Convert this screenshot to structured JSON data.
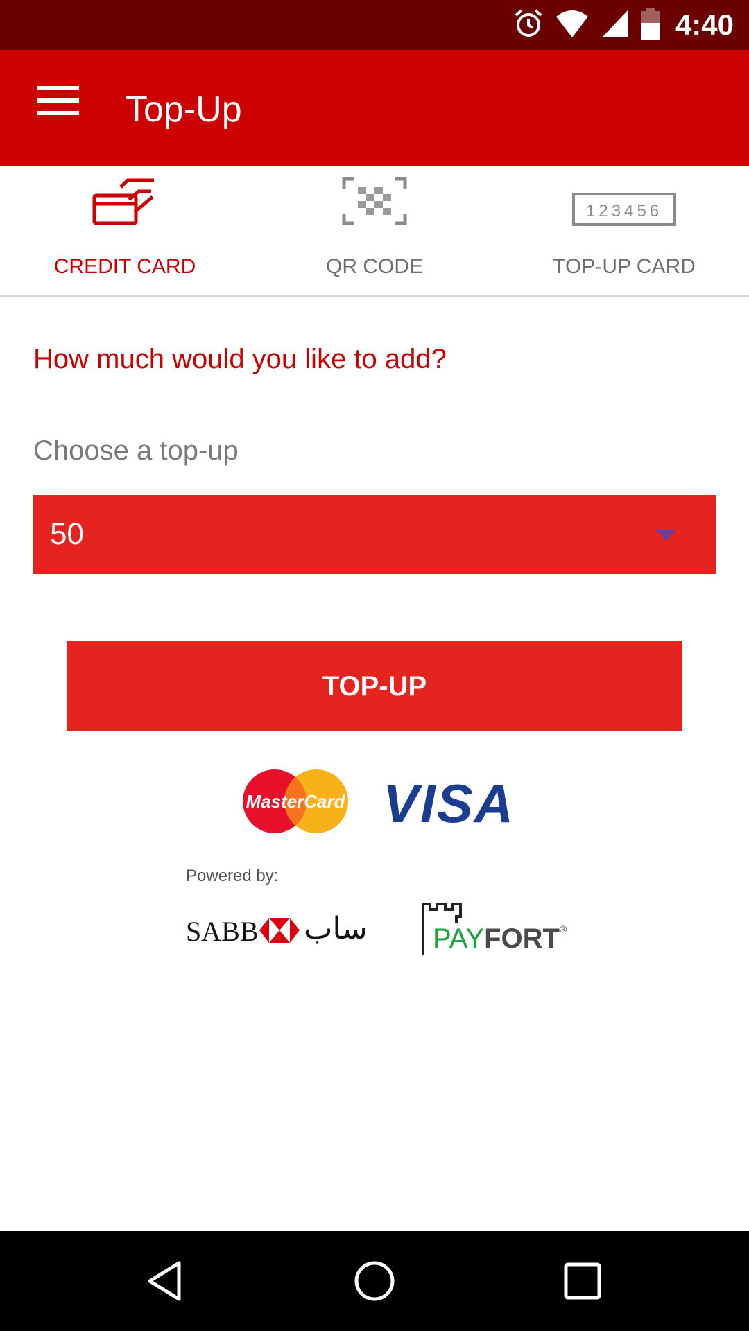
{
  "status_bar": {
    "time": "4:40",
    "icons": [
      "alarm-icon",
      "wifi-icon",
      "cell-signal-icon",
      "battery-icon"
    ]
  },
  "app_bar": {
    "title": "Top-Up",
    "menu_icon": "menu-icon"
  },
  "tabs": [
    {
      "label": "CREDIT CARD",
      "icon": "credit-card-icon",
      "active": true
    },
    {
      "label": "QR CODE",
      "icon": "qr-code-icon",
      "active": false
    },
    {
      "label": "TOP-UP CARD",
      "icon": "topup-card-icon",
      "icon_text": "123456",
      "active": false
    }
  ],
  "form": {
    "question": "How much would you like to add?",
    "choose_label": "Choose a top-up",
    "selected_amount": "50",
    "submit_label": "TOP-UP"
  },
  "payment": {
    "mastercard_text": "MasterCard",
    "visa_text": "VISA",
    "powered_by": "Powered by:",
    "sabb_text": "SABB",
    "sabb_arabic": "ساب",
    "payfort_pay": "PAY",
    "payfort_fort": "FORT",
    "payfort_reg": "®"
  },
  "nav_bar": {
    "buttons": [
      "back-icon",
      "home-icon",
      "recents-icon"
    ]
  },
  "colors": {
    "status_bar": "#6b0000",
    "app_bar": "#cc0000",
    "accent": "#e52420",
    "active_tab": "#cc0000",
    "inactive_tab": "#6f6f6f"
  }
}
